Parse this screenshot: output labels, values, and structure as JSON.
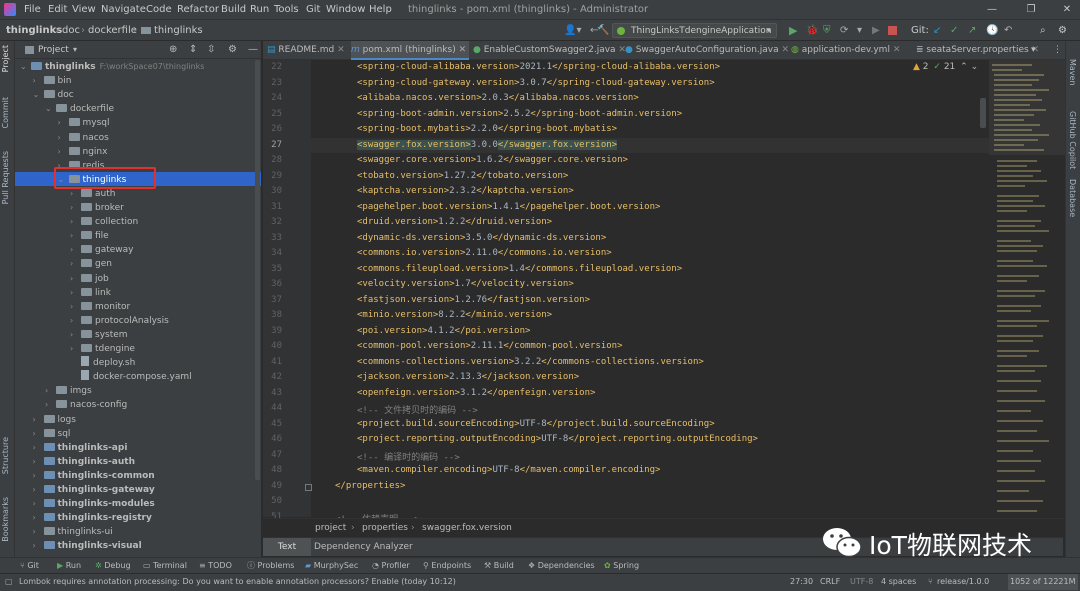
{
  "menubar": {
    "items": [
      "File",
      "Edit",
      "View",
      "Navigate",
      "Code",
      "Refactor",
      "Build",
      "Run",
      "Tools",
      "Git",
      "Window",
      "Help"
    ],
    "window_title": "thinglinks - pom.xml (thinglinks) - Administrator"
  },
  "navbar": {
    "breadcrumbs": [
      "thinglinks",
      "doc",
      "dockerfile",
      "thinglinks"
    ],
    "run_config": "ThingLinksTdengineApplication",
    "git_label": "Git:"
  },
  "left_strip": [
    "Project",
    "Commit",
    "Pull Requests",
    "Structure",
    "Bookmarks"
  ],
  "right_strip": [
    "Maven",
    "GitHub Copilot",
    "Database"
  ],
  "project_panel": {
    "title": "Project",
    "tree": [
      {
        "label": "thinglinks",
        "extra": "F:\\workSpace07\\thinglinks",
        "depth": 0,
        "arrow": "v",
        "bold": true
      },
      {
        "label": "bin",
        "depth": 1,
        "arrow": ">"
      },
      {
        "label": "doc",
        "depth": 1,
        "arrow": "v"
      },
      {
        "label": "dockerfile",
        "depth": 2,
        "arrow": "v"
      },
      {
        "label": "mysql",
        "depth": 3,
        "arrow": ">"
      },
      {
        "label": "nacos",
        "depth": 3,
        "arrow": ">"
      },
      {
        "label": "nginx",
        "depth": 3,
        "arrow": ">"
      },
      {
        "label": "redis",
        "depth": 3,
        "arrow": ">"
      },
      {
        "label": "thinglinks",
        "depth": 3,
        "arrow": "v",
        "selected": true
      },
      {
        "label": "auth",
        "depth": 4,
        "arrow": ">"
      },
      {
        "label": "broker",
        "depth": 4,
        "arrow": ">"
      },
      {
        "label": "collection",
        "depth": 4,
        "arrow": ">"
      },
      {
        "label": "file",
        "depth": 4,
        "arrow": ">"
      },
      {
        "label": "gateway",
        "depth": 4,
        "arrow": ">"
      },
      {
        "label": "gen",
        "depth": 4,
        "arrow": ">"
      },
      {
        "label": "job",
        "depth": 4,
        "arrow": ">"
      },
      {
        "label": "link",
        "depth": 4,
        "arrow": ">"
      },
      {
        "label": "monitor",
        "depth": 4,
        "arrow": ">"
      },
      {
        "label": "protocolAnalysis",
        "depth": 4,
        "arrow": ">"
      },
      {
        "label": "system",
        "depth": 4,
        "arrow": ">"
      },
      {
        "label": "tdengine",
        "depth": 4,
        "arrow": ">"
      },
      {
        "label": "deploy.sh",
        "depth": 4,
        "arrow": "",
        "file": true
      },
      {
        "label": "docker-compose.yaml",
        "depth": 4,
        "arrow": "",
        "file": true
      },
      {
        "label": "imgs",
        "depth": 2,
        "arrow": ">"
      },
      {
        "label": "nacos-config",
        "depth": 2,
        "arrow": ">"
      },
      {
        "label": "logs",
        "depth": 1,
        "arrow": ">"
      },
      {
        "label": "sql",
        "depth": 1,
        "arrow": ">"
      },
      {
        "label": "thinglinks-api",
        "depth": 1,
        "arrow": ">",
        "bold": true
      },
      {
        "label": "thinglinks-auth",
        "depth": 1,
        "arrow": ">",
        "bold": true
      },
      {
        "label": "thinglinks-common",
        "depth": 1,
        "arrow": ">",
        "bold": true
      },
      {
        "label": "thinglinks-gateway",
        "depth": 1,
        "arrow": ">",
        "bold": true
      },
      {
        "label": "thinglinks-modules",
        "depth": 1,
        "arrow": ">",
        "bold": true
      },
      {
        "label": "thinglinks-registry",
        "depth": 1,
        "arrow": ">",
        "bold": true
      },
      {
        "label": "thinglinks-ui",
        "depth": 1,
        "arrow": ">"
      },
      {
        "label": "thinglinks-visual",
        "depth": 1,
        "arrow": ">",
        "bold": true
      }
    ]
  },
  "editor_tabs": [
    {
      "label": "README.md",
      "active": false
    },
    {
      "label": "pom.xml (thinglinks)",
      "active": true
    },
    {
      "label": "EnableCustomSwagger2.java",
      "active": false
    },
    {
      "label": "SwaggerAutoConfiguration.java",
      "active": false
    },
    {
      "label": "application-dev.yml",
      "active": false
    },
    {
      "label": "seataServer.properties",
      "active": false
    }
  ],
  "inspections": {
    "warnings": "2",
    "weak": "21"
  },
  "code_lines": [
    {
      "n": "22",
      "tag": "spring-cloud-alibaba.version",
      "val": "2021.1"
    },
    {
      "n": "23",
      "tag": "spring-cloud-gateway.version",
      "val": "3.0.7"
    },
    {
      "n": "24",
      "tag": "alibaba.nacos.version",
      "val": "2.0.3"
    },
    {
      "n": "25",
      "tag": "spring-boot-admin.version",
      "val": "2.5.2"
    },
    {
      "n": "26",
      "tag": "spring-boot.mybatis",
      "val": "2.2.0"
    },
    {
      "n": "27",
      "tag": "swagger.fox.version",
      "val": "3.0.0",
      "current": true
    },
    {
      "n": "28",
      "tag": "swagger.core.version",
      "val": "1.6.2"
    },
    {
      "n": "29",
      "tag": "tobato.version",
      "val": "1.27.2"
    },
    {
      "n": "30",
      "tag": "kaptcha.version",
      "val": "2.3.2"
    },
    {
      "n": "31",
      "tag": "pagehelper.boot.version",
      "val": "1.4.1"
    },
    {
      "n": "32",
      "tag": "druid.version",
      "val": "1.2.2"
    },
    {
      "n": "33",
      "tag": "dynamic-ds.version",
      "val": "3.5.0"
    },
    {
      "n": "34",
      "tag": "commons.io.version",
      "val": "2.11.0"
    },
    {
      "n": "35",
      "tag": "commons.fileupload.version",
      "val": "1.4"
    },
    {
      "n": "36",
      "tag": "velocity.version",
      "val": "1.7"
    },
    {
      "n": "37",
      "tag": "fastjson.version",
      "val": "1.2.76"
    },
    {
      "n": "38",
      "tag": "minio.version",
      "val": "8.2.2"
    },
    {
      "n": "39",
      "tag": "poi.version",
      "val": "4.1.2"
    },
    {
      "n": "40",
      "tag": "common-pool.version",
      "val": "2.11.1"
    },
    {
      "n": "41",
      "tag": "commons-collections.version",
      "val": "3.2.2"
    },
    {
      "n": "42",
      "tag": "jackson.version",
      "val": "2.13.3"
    },
    {
      "n": "43",
      "tag": "openfeign.version",
      "val": "3.1.2"
    },
    {
      "n": "44",
      "comment": "<!-- 文件拷贝时的编码 -->"
    },
    {
      "n": "45",
      "tag": "project.build.sourceEncoding",
      "val": "UTF-8"
    },
    {
      "n": "46",
      "tag": "project.reporting.outputEncoding",
      "val": "UTF-8"
    },
    {
      "n": "47",
      "comment": "<!-- 编译时的编码 -->"
    },
    {
      "n": "48",
      "tag": "maven.compiler.encoding",
      "val": "UTF-8"
    },
    {
      "n": "49",
      "close": "</properties>"
    },
    {
      "n": "50",
      "blank": true
    },
    {
      "n": "51",
      "comment": "<!-- 依赖声明 -->"
    }
  ],
  "breadcrumb_bar": [
    "project",
    "properties",
    "swagger.fox.version"
  ],
  "bottom_tabs": [
    "Text",
    "Dependency Analyzer"
  ],
  "tool_windows": [
    "Git",
    "Run",
    "Debug",
    "Terminal",
    "TODO",
    "Problems",
    "MurphySec",
    "Profiler",
    "Endpoints",
    "Build",
    "Dependencies",
    "Spring"
  ],
  "status": {
    "message": "Lombok requires annotation processing: Do you want to enable annotation processors? Enable (today 10:12)",
    "position": "27:30",
    "line_sep": "CRLF",
    "encoding": "UTF-8",
    "indent": "4 spaces",
    "branch": "release/1.0.0",
    "memory": "1052 of 12221M"
  },
  "watermark": "IoT物联网技术",
  "colors": {
    "accent": "#2f65ca",
    "highlight_box": "#e03030",
    "tag": "#e8bf6a",
    "value": "#a9b7c6",
    "comment": "#808080"
  }
}
